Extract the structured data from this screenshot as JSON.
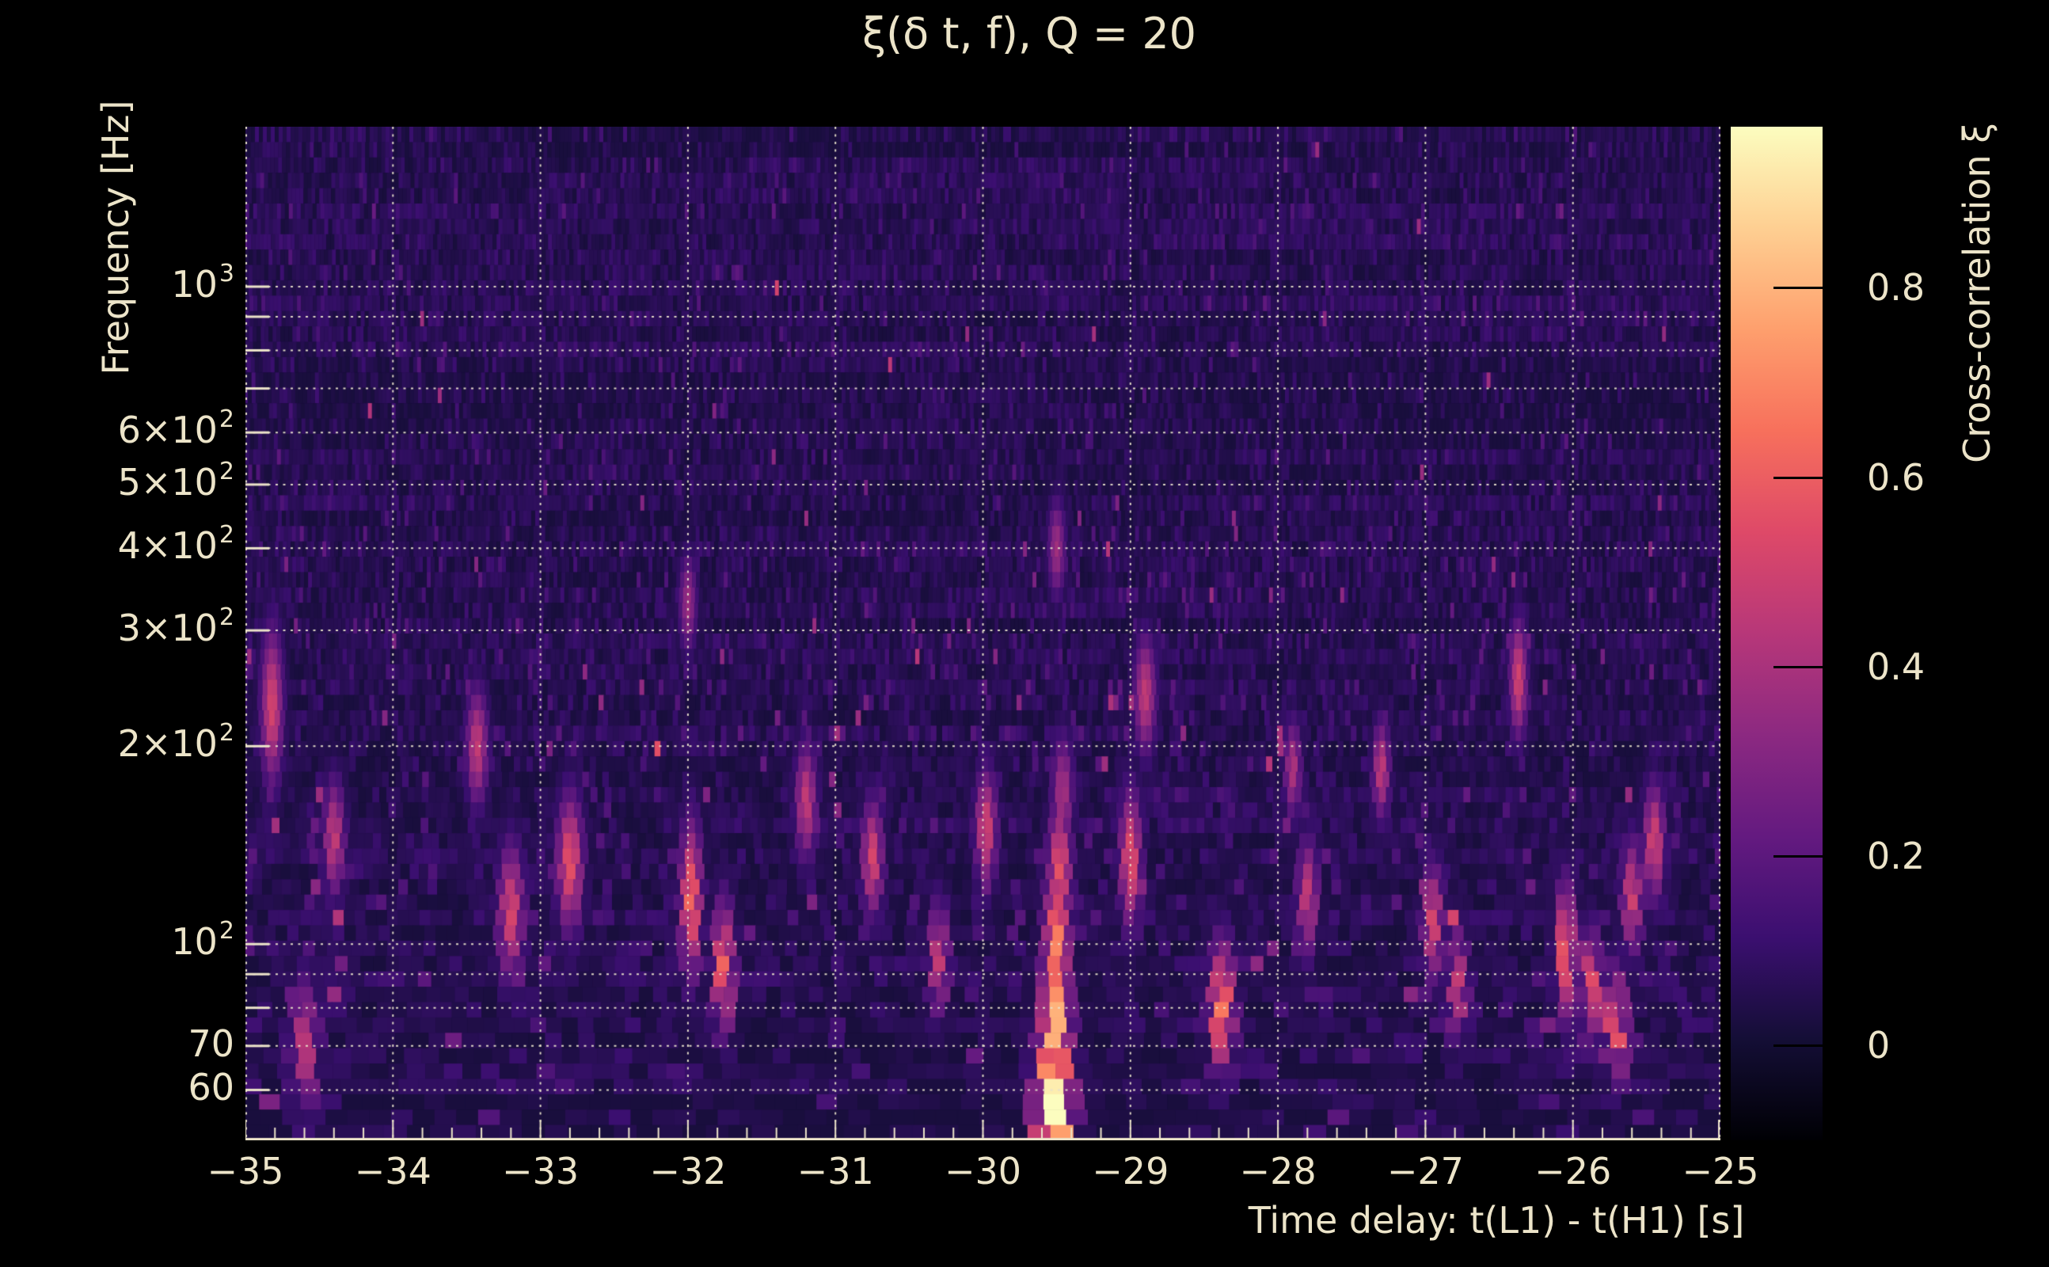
{
  "title": "ξ(δ t, f), Q = 20",
  "axes": {
    "x": {
      "label": "Time delay: t(L1) - t(H1) [s]",
      "range_s": [
        -35,
        -25
      ],
      "ticks": [
        {
          "label": "−35",
          "value": -35
        },
        {
          "label": "−34",
          "value": -34
        },
        {
          "label": "−33",
          "value": -33
        },
        {
          "label": "−32",
          "value": -32
        },
        {
          "label": "−31",
          "value": -31
        },
        {
          "label": "−30",
          "value": -30
        },
        {
          "label": "−29",
          "value": -29
        },
        {
          "label": "−28",
          "value": -28
        },
        {
          "label": "−27",
          "value": -27
        },
        {
          "label": "−26",
          "value": -26
        },
        {
          "label": "−25",
          "value": -25
        }
      ],
      "minor_tick_step_s": 0.2
    },
    "y": {
      "label": "Frequency [Hz]",
      "scale": "log",
      "range_hz": [
        50.3,
        1751
      ],
      "ticks": [
        {
          "label": "10",
          "sup": "3",
          "value": 1000
        },
        {
          "label": "6×10",
          "sup": "2",
          "value": 600
        },
        {
          "label": "5×10",
          "sup": "2",
          "value": 500
        },
        {
          "label": "4×10",
          "sup": "2",
          "value": 400
        },
        {
          "label": "3×10",
          "sup": "2",
          "value": 300
        },
        {
          "label": "2×10",
          "sup": "2",
          "value": 200
        },
        {
          "label": "10",
          "sup": "2",
          "value": 100
        },
        {
          "label": "70",
          "sup": "",
          "value": 70
        },
        {
          "label": "60",
          "sup": "",
          "value": 60
        }
      ],
      "grid_hz": [
        1000,
        900,
        800,
        700,
        600,
        500,
        400,
        300,
        200,
        100,
        90,
        80,
        70,
        60
      ]
    }
  },
  "colorbar": {
    "label": "Cross-correlation ξ",
    "value_range": [
      -0.1,
      0.97
    ],
    "ticks": [
      {
        "label": "0.8",
        "value": 0.8
      },
      {
        "label": "0.6",
        "value": 0.6
      },
      {
        "label": "0.4",
        "value": 0.4
      },
      {
        "label": "0.2",
        "value": 0.2
      },
      {
        "label": "0",
        "value": 0.0
      }
    ],
    "colormap": "magma",
    "colormap_stops": [
      "#000004",
      "#140e36",
      "#3b0f70",
      "#641a80",
      "#8c2981",
      "#b73779",
      "#de4968",
      "#f7705c",
      "#fe9f6d",
      "#fecf92",
      "#fcfdbf"
    ]
  },
  "colors": {
    "background": "#000000",
    "text": "#ece4c9",
    "grid": "#e8e1ca",
    "spine": "#ece4c9",
    "colorbar_tick": "#000000"
  },
  "chart_data": {
    "type": "heatmap",
    "title": "ξ(δ t, f), Q = 20",
    "xlabel": "Time delay: t(L1) - t(H1) [s]",
    "ylabel": "Frequency [Hz]",
    "x_range_s": [
      -35,
      -25
    ],
    "y_range_hz": [
      50.3,
      1751
    ],
    "y_scale": "log",
    "value_range": [
      -0.1,
      0.97
    ],
    "grid": "dotted, cream, at integer seconds and log-decade frequencies",
    "peak": {
      "time_delay_s": -29.52,
      "frequency_hz": 56,
      "xi": 0.97
    },
    "noise_seed": 20,
    "noise_background_xi": {
      "mean": 0.055,
      "sigma": 0.028
    },
    "hotspots": [
      {
        "t": -29.52,
        "f": 56,
        "xi": 0.97,
        "dt": 0.085,
        "df": 0.1
      },
      {
        "t": -29.51,
        "f": 75,
        "xi": 0.82,
        "dt": 0.07,
        "df": 0.09
      },
      {
        "t": -29.5,
        "f": 100,
        "xi": 0.68,
        "dt": 0.06,
        "df": 0.08
      },
      {
        "t": -29.48,
        "f": 130,
        "xi": 0.55,
        "dt": 0.055,
        "df": 0.07
      },
      {
        "t": -29.46,
        "f": 170,
        "xi": 0.38,
        "dt": 0.05,
        "df": 0.06
      },
      {
        "t": -29.5,
        "f": 400,
        "xi": 0.36,
        "dt": 0.04,
        "df": 0.05
      },
      {
        "t": -29.0,
        "f": 135,
        "xi": 0.55,
        "dt": 0.05,
        "df": 0.07
      },
      {
        "t": -31.98,
        "f": 117,
        "xi": 0.62,
        "dt": 0.05,
        "df": 0.08
      },
      {
        "t": -31.76,
        "f": 92,
        "xi": 0.6,
        "dt": 0.05,
        "df": 0.07
      },
      {
        "t": -32.8,
        "f": 133,
        "xi": 0.55,
        "dt": 0.06,
        "df": 0.07
      },
      {
        "t": -34.82,
        "f": 230,
        "xi": 0.5,
        "dt": 0.05,
        "df": 0.08
      },
      {
        "t": -34.6,
        "f": 70,
        "xi": 0.42,
        "dt": 0.07,
        "df": 0.07
      },
      {
        "t": -34.4,
        "f": 145,
        "xi": 0.45,
        "dt": 0.05,
        "df": 0.06
      },
      {
        "t": -33.43,
        "f": 200,
        "xi": 0.45,
        "dt": 0.05,
        "df": 0.06
      },
      {
        "t": -33.2,
        "f": 112,
        "xi": 0.5,
        "dt": 0.06,
        "df": 0.07
      },
      {
        "t": -32.0,
        "f": 330,
        "xi": 0.35,
        "dt": 0.04,
        "df": 0.05
      },
      {
        "t": -31.2,
        "f": 165,
        "xi": 0.45,
        "dt": 0.05,
        "df": 0.06
      },
      {
        "t": -30.75,
        "f": 135,
        "xi": 0.5,
        "dt": 0.05,
        "df": 0.06
      },
      {
        "t": -30.3,
        "f": 95,
        "xi": 0.45,
        "dt": 0.05,
        "df": 0.06
      },
      {
        "t": -29.98,
        "f": 150,
        "xi": 0.5,
        "dt": 0.05,
        "df": 0.06
      },
      {
        "t": -28.9,
        "f": 240,
        "xi": 0.45,
        "dt": 0.05,
        "df": 0.06
      },
      {
        "t": -28.38,
        "f": 80,
        "xi": 0.65,
        "dt": 0.06,
        "df": 0.07
      },
      {
        "t": -27.9,
        "f": 185,
        "xi": 0.4,
        "dt": 0.04,
        "df": 0.05
      },
      {
        "t": -27.8,
        "f": 118,
        "xi": 0.45,
        "dt": 0.05,
        "df": 0.06
      },
      {
        "t": -27.3,
        "f": 184,
        "xi": 0.45,
        "dt": 0.04,
        "df": 0.05
      },
      {
        "t": -26.95,
        "f": 108,
        "xi": 0.5,
        "dt": 0.05,
        "df": 0.06
      },
      {
        "t": -26.78,
        "f": 86,
        "xi": 0.45,
        "dt": 0.05,
        "df": 0.06
      },
      {
        "t": -26.37,
        "f": 253,
        "xi": 0.5,
        "dt": 0.04,
        "df": 0.06
      },
      {
        "t": -26.05,
        "f": 98,
        "xi": 0.6,
        "dt": 0.05,
        "df": 0.07
      },
      {
        "t": -25.88,
        "f": 86,
        "xi": 0.55,
        "dt": 0.05,
        "df": 0.06
      },
      {
        "t": -25.71,
        "f": 75,
        "xi": 0.62,
        "dt": 0.05,
        "df": 0.06
      },
      {
        "t": -25.6,
        "f": 118,
        "xi": 0.48,
        "dt": 0.05,
        "df": 0.06
      },
      {
        "t": -25.45,
        "f": 143,
        "xi": 0.5,
        "dt": 0.05,
        "df": 0.06
      }
    ]
  }
}
